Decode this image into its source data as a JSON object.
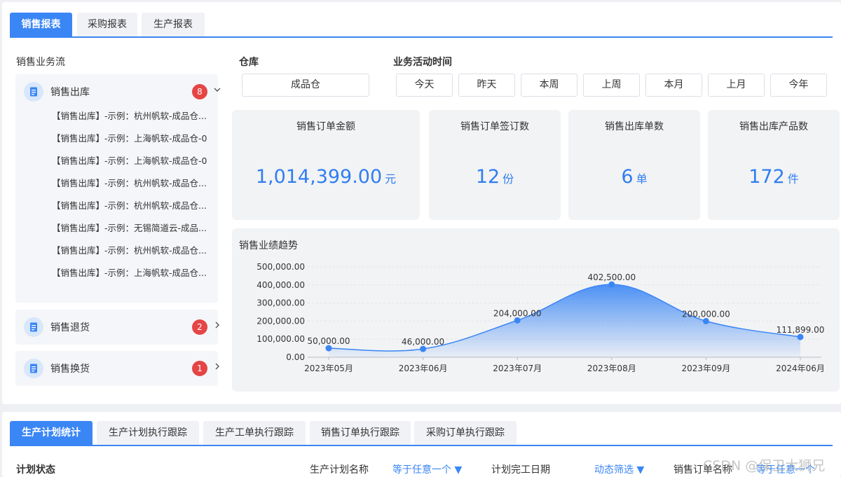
{
  "top_tabs": [
    "销售报表",
    "采购报表",
    "生产报表"
  ],
  "left": {
    "title": "销售业务流",
    "groups": [
      {
        "title": "销售出库",
        "count": "8",
        "items": [
          "【销售出库】-示例：杭州帆软-成品仓...",
          "【销售出库】-示例：上海帆软-成品仓-0",
          "【销售出库】-示例：上海帆软-成品仓-0",
          "【销售出库】-示例：杭州帆软-成品仓...",
          "【销售出库】-示例：杭州帆软-成品仓...",
          "【销售出库】-示例：无锡简道云-成品...",
          "【销售出库】-示例：杭州帆软-成品仓...",
          "【销售出库】-示例：上海帆软-成品仓..."
        ]
      },
      {
        "title": "销售退货",
        "count": "2"
      },
      {
        "title": "销售换货",
        "count": "1"
      }
    ]
  },
  "filters": {
    "warehouse_label": "仓库",
    "warehouse_value": "成品仓",
    "time_label": "业务活动时间",
    "time_options": [
      "今天",
      "昨天",
      "本周",
      "上周",
      "本月",
      "上月",
      "今年"
    ]
  },
  "kpis": [
    {
      "label": "销售订单金额",
      "value": "1,014,399.00",
      "unit": "元"
    },
    {
      "label": "销售订单签订数",
      "value": "12",
      "unit": "份"
    },
    {
      "label": "销售出库单数",
      "value": "6",
      "unit": "单"
    },
    {
      "label": "销售出库产品数",
      "value": "172",
      "unit": "件"
    }
  ],
  "chart_data": {
    "type": "area",
    "title": "销售业绩趋势",
    "categories": [
      "2023年05月",
      "2023年06月",
      "2023年07月",
      "2023年08月",
      "2023年09月",
      "2024年06月"
    ],
    "values": [
      50000,
      46000,
      204000,
      402500,
      200000,
      111899
    ],
    "data_labels": [
      "50,000.00",
      "46,000.00",
      "204,000.00",
      "402,500.00",
      "200,000.00",
      "111,899.00"
    ],
    "y_ticks": [
      "0.00",
      "100,000.00",
      "200,000.00",
      "300,000.00",
      "400,000.00",
      "500,000.00"
    ],
    "ylim": [
      0,
      500000
    ],
    "color": "#3a86f5"
  },
  "bottom_tabs": [
    "生产计划统计",
    "生产计划执行跟踪",
    "生产工单执行跟踪",
    "销售订单执行跟踪",
    "采购订单执行跟踪"
  ],
  "bottom_filters": {
    "status_label": "计划状态",
    "plan_name_label": "生产计划名称",
    "plan_name_value": "等于任意一个",
    "finish_date_label": "计划完工日期",
    "finish_date_value": "动态筛选",
    "order_name_label": "销售订单名称",
    "order_name_value": "等于任意一个"
  },
  "watermark": "CSDN @保卫大狮兄"
}
